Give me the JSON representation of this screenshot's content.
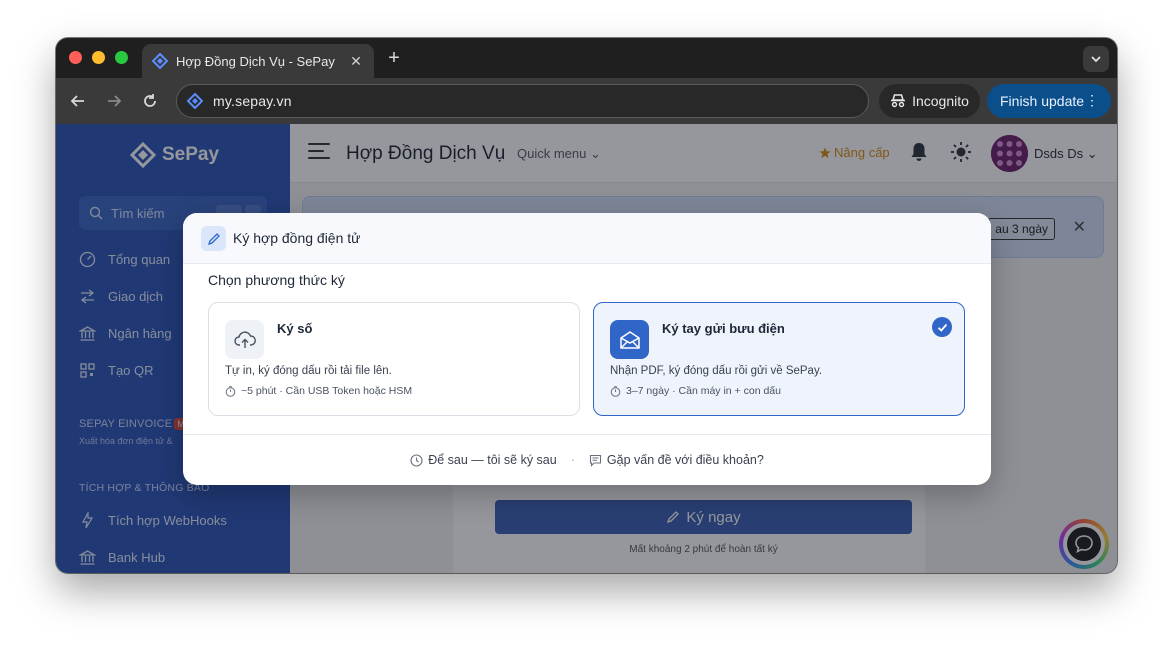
{
  "browser": {
    "tab_title": "Hợp Đồng Dịch Vụ - SePay",
    "tab_close": "✕",
    "new_tab": "+",
    "url": "my.sepay.vn",
    "incognito_label": "Incognito",
    "finish_update_label": "Finish update",
    "finish_menu": "⋮"
  },
  "sidebar": {
    "brand": "SePay",
    "search_label": "Tìm kiếm",
    "items": [
      {
        "label": "Tổng quan",
        "icon": "gauge-icon"
      },
      {
        "label": "Giao dịch",
        "icon": "transfer-icon"
      },
      {
        "label": "Ngân hàng",
        "icon": "bank-icon"
      },
      {
        "label": "Tạo QR",
        "icon": "qr-icon"
      }
    ],
    "section_einvoice": "SEPAY EINVOICE",
    "section_einvoice_badge": "M",
    "section_einvoice_sub": "Xuất hóa đơn điện tử &",
    "section_integration": "TÍCH HỢP & THÔNG BÁO",
    "integration_items": [
      {
        "label": "Tích hợp WebHooks",
        "icon": "webhook-icon"
      },
      {
        "label": "Bank Hub",
        "icon": "bank-hub-icon"
      }
    ]
  },
  "header": {
    "title": "Hợp Đồng Dịch Vụ",
    "quick_menu": "Quick menu ⌄",
    "upgrade": "Nâng cấp",
    "user_name": "Dsds Ds ⌄"
  },
  "notice": {
    "button": "au 3 ngày",
    "close": "✕"
  },
  "background_card": {
    "sign_button": "Ký ngay",
    "sign_note": "Mất khoảng 2 phút để hoàn tất ký"
  },
  "modal": {
    "title": "Ký hợp đồng điện tử",
    "subtitle": "Chọn phương thức ký",
    "options": [
      {
        "title": "Ký số",
        "desc": "Tự in, ký đóng dấu rồi tải file lên.",
        "meta": "~5 phút · Cần USB Token hoặc HSM",
        "selected": false
      },
      {
        "title": "Ký tay gửi bưu điện",
        "desc": "Nhận PDF, ký đóng dấu rồi gửi về SePay.",
        "meta": "3–7 ngày · Cần máy in + con dấu",
        "selected": true
      }
    ],
    "footer_later": "Để sau — tôi sẽ ký sau",
    "footer_separator": "·",
    "footer_issue": "Gặp vấn đề với điều khoản?"
  },
  "colors": {
    "brand": "#2a55b8",
    "accent": "#2f66c8",
    "upgrade": "#d98a12"
  }
}
